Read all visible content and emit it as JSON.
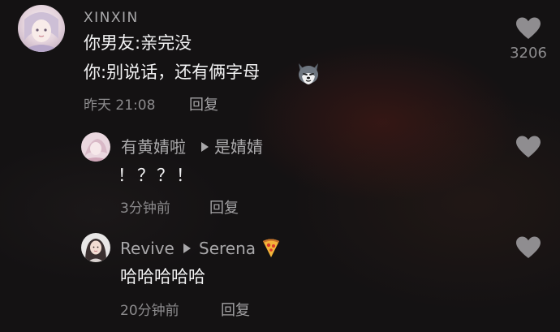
{
  "comments": [
    {
      "username": "XINXIN",
      "lines": [
        "你男友:亲完没",
        "你:别说话，还有俩字母"
      ],
      "time": "昨天 21:08",
      "reply_label": "回复",
      "like_count": "3206"
    }
  ],
  "replies": [
    {
      "username": "有黄婧啦",
      "reply_to": "是婧婧",
      "text": "！？？！",
      "time": "3分钟前",
      "reply_label": "回复"
    },
    {
      "username": "Revive",
      "reply_to": "Serena",
      "text": "哈哈哈哈哈",
      "time": "20分钟前",
      "reply_label": "回复"
    }
  ],
  "icons": {
    "like": "heart-icon",
    "reply_arrow": "triangle-right-icon",
    "emoji_wolf": "husky-emoji",
    "emoji_pizza": "pizza-emoji"
  },
  "colors": {
    "background": "#141213",
    "username": "#a9a8aa",
    "text": "#f2f2f3",
    "meta": "#8c8b8d",
    "heart": "#8f8d90"
  }
}
